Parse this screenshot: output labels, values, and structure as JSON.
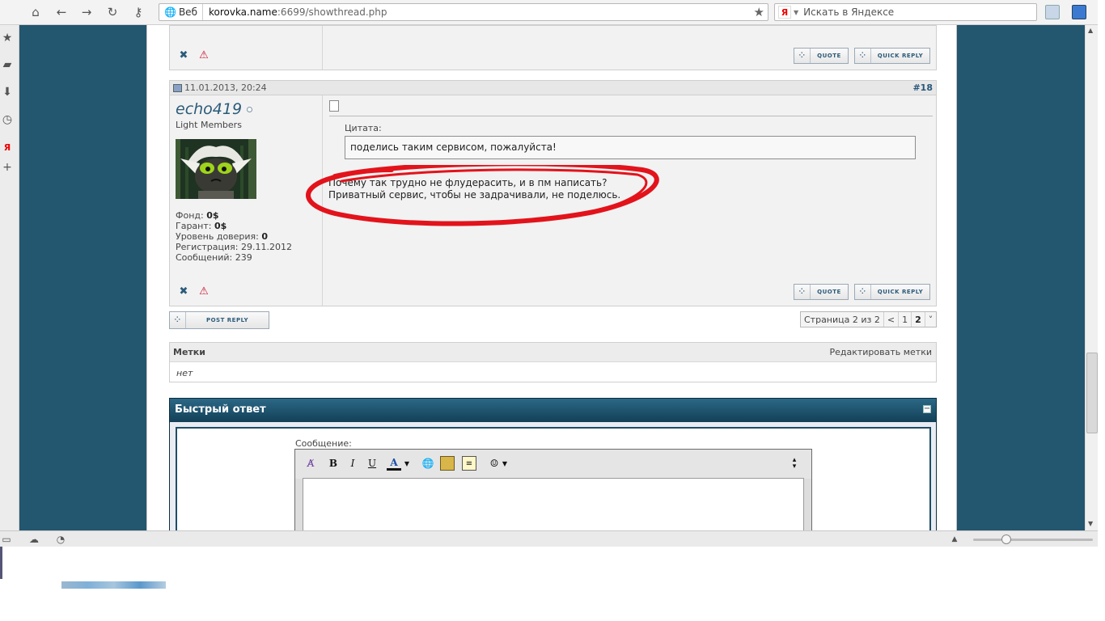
{
  "browser": {
    "proto_label": "Веб",
    "url_host": "korovka.name",
    "url_rest": ":6699/showthread.php",
    "search_placeholder": "Искать в Яндексе"
  },
  "post_top": {
    "quote_label": "Quote",
    "quick_reply_label": "Quick reply"
  },
  "post": {
    "date": "11.01.2013, 20:24",
    "number": "#18",
    "username": "echo419",
    "rank": "Light Members",
    "fund_label": "Фонд:",
    "fund_value": "0$",
    "guarantee_label": "Гарант:",
    "guarantee_value": "0$",
    "trust_label": "Уровень доверия:",
    "trust_value": "0",
    "reg_label": "Регистрация:",
    "reg_value": "29.11.2012",
    "posts_label": "Сообщений:",
    "posts_value": "239",
    "quote_title": "Цитата:",
    "quote_text": "поделись таким сервисом, пожалуйста!",
    "message_line1": "Почему так трудно не флудерасить, и в пм написать?",
    "message_line2": "Приватный сервис, чтобы не задрачивали, не поделюсь.",
    "quote_label": "Quote",
    "quick_reply_label": "Quick reply"
  },
  "post_reply_label": "Post reply",
  "pagination": {
    "text": "Страница 2 из 2",
    "prev": "<",
    "page1": "1",
    "page2": "2",
    "menu": "˅"
  },
  "tags": {
    "title": "Метки",
    "edit": "Редактировать метки",
    "value": "нет"
  },
  "quick_reply": {
    "title": "Быстрый ответ",
    "message_label": "Сообщение:"
  },
  "colors": {
    "page_background": "#23566f",
    "link": "#2b5b7a",
    "annotation_red": "#e3131b"
  }
}
